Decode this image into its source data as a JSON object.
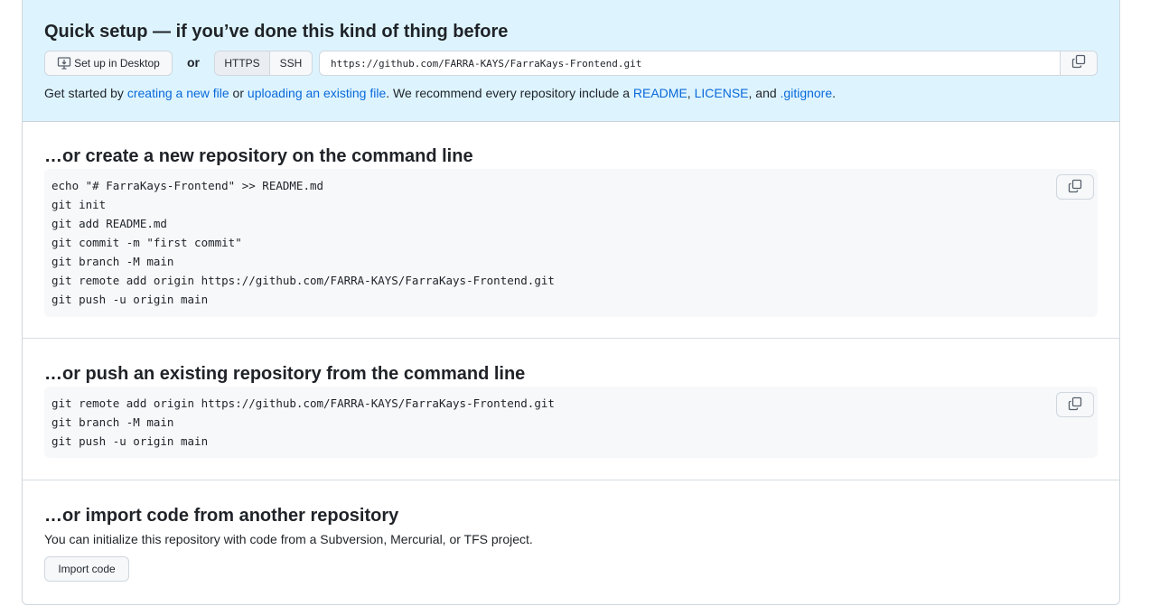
{
  "quick_setup": {
    "title": "Quick setup — if you’ve done this kind of thing before",
    "desktop_button": "Set up in Desktop",
    "or_label": "or",
    "protocols": [
      "HTTPS",
      "SSH"
    ],
    "selected_protocol": "HTTPS",
    "clone_url": "https://github.com/FARRA-KAYS/FarraKays-Frontend.git",
    "getstarted": {
      "t1": "Get started by ",
      "link1": "creating a new file",
      "t2": " or ",
      "link2": "uploading an existing file",
      "t3": ". We recommend every repository include a ",
      "link3": "README",
      "t4": ", ",
      "link4": "LICENSE",
      "t5": ", and ",
      "link5": ".gitignore",
      "t6": "."
    }
  },
  "create_new": {
    "title": "…or create a new repository on the command line",
    "lines": [
      "echo \"# FarraKays-Frontend\" >> README.md",
      "git init",
      "git add README.md",
      "git commit -m \"first commit\"",
      "git branch -M main",
      "git remote add origin https://github.com/FARRA-KAYS/FarraKays-Frontend.git",
      "git push -u origin main"
    ]
  },
  "push_existing": {
    "title": "…or push an existing repository from the command line",
    "lines": [
      "git remote add origin https://github.com/FARRA-KAYS/FarraKays-Frontend.git",
      "git branch -M main",
      "git push -u origin main"
    ]
  },
  "import": {
    "title": "…or import code from another repository",
    "description": "You can initialize this repository with code from a Subversion, Mercurial, or TFS project.",
    "button": "Import code"
  },
  "colors": {
    "quick_setup_bg": "#ddf4ff",
    "link": "#0969da",
    "code_bg": "#f6f8fa"
  }
}
